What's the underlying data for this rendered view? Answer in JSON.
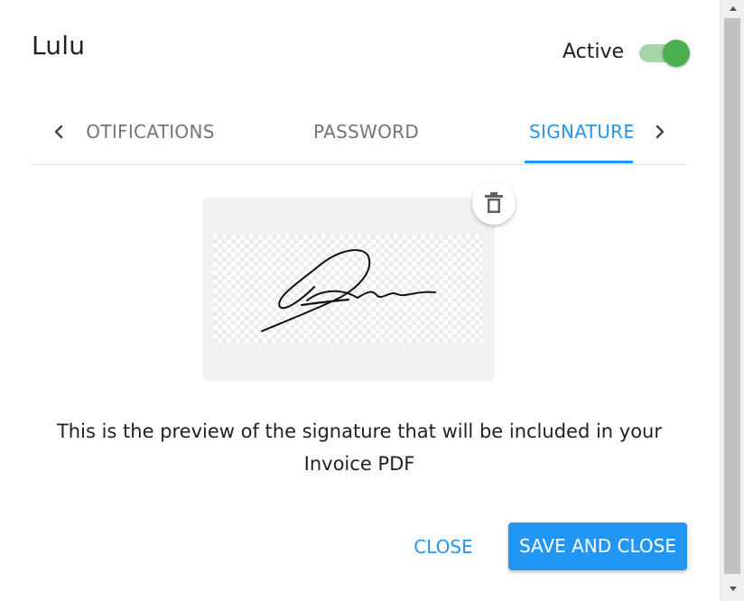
{
  "dialog": {
    "user_name": "Lulu",
    "active_label": "Active",
    "active_on": true
  },
  "tabs": {
    "items": [
      {
        "label": "NOTIFICATIONS",
        "selected": false
      },
      {
        "label": "PASSWORD",
        "selected": false
      },
      {
        "label": "SIGNATURE",
        "selected": true
      }
    ],
    "prev_icon": "chevron-left-icon",
    "next_icon": "chevron-right-icon"
  },
  "signature": {
    "delete_icon": "trash-icon",
    "preview_text": "This is the preview of the signature that will be included in your Invoice PDF"
  },
  "actions": {
    "close_label": "CLOSE",
    "save_label": "SAVE AND CLOSE"
  },
  "colors": {
    "accent": "#2196f3",
    "toggle_on": "#4caf50",
    "toggle_track": "#a5d6a7"
  }
}
